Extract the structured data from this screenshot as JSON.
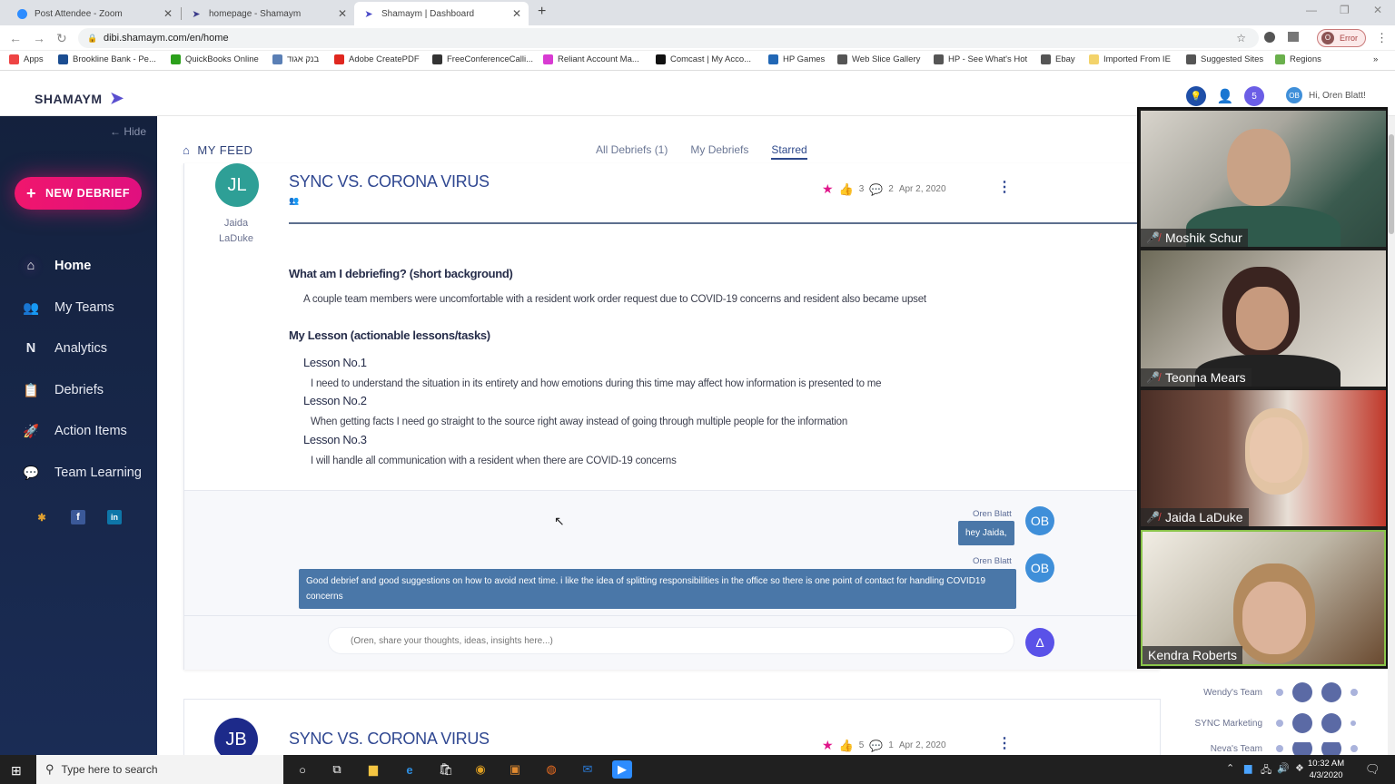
{
  "browser": {
    "tabs": [
      {
        "label": "Post Attendee - Zoom",
        "icon": "zoom-icon"
      },
      {
        "label": "homepage - Shamaym",
        "icon": "shamaym-icon"
      },
      {
        "label": "Shamaym | Dashboard",
        "icon": "shamaym-icon",
        "active": true
      }
    ],
    "url": "dibi.shamaym.com/en/home",
    "error_label": "Error",
    "profile_initial": "O",
    "bookmarks": [
      {
        "label": "Apps",
        "icon": "apps-grid-icon",
        "color": "#e44"
      },
      {
        "label": "Brookline Bank - Pe...",
        "icon": "bb-icon",
        "color": "#1b4d91"
      },
      {
        "label": "QuickBooks Online",
        "icon": "quickbooks-icon",
        "color": "#2ca01c"
      },
      {
        "label": "בנק אגוד",
        "icon": "bank-icon",
        "color": "#5a7fb5"
      },
      {
        "label": "Adobe CreatePDF",
        "icon": "adobe-icon",
        "color": "#e0271f"
      },
      {
        "label": "FreeConferenceCalli...",
        "icon": "conference-icon",
        "color": "#333"
      },
      {
        "label": "Reliant Account Ma...",
        "icon": "reliant-icon",
        "color": "#d83bd2"
      },
      {
        "label": "Comcast | My Acco...",
        "icon": "comcast-icon",
        "color": "#111"
      },
      {
        "label": "HP Games",
        "icon": "hp-games-icon",
        "color": "#2167b5"
      },
      {
        "label": "Web Slice Gallery",
        "icon": "globe-icon",
        "color": "#555"
      },
      {
        "label": "HP - See What's Hot",
        "icon": "globe-icon",
        "color": "#555"
      },
      {
        "label": "Ebay",
        "icon": "globe-icon",
        "color": "#555"
      },
      {
        "label": "Imported From IE",
        "icon": "folder-icon",
        "color": "#f3d36b"
      },
      {
        "label": "Suggested Sites",
        "icon": "globe-icon",
        "color": "#555"
      },
      {
        "label": "Regions",
        "icon": "regions-icon",
        "color": "#6ab04c"
      }
    ]
  },
  "app": {
    "logo": "SHAMAYM",
    "greeting": "Hi, Oren Blatt!",
    "user_initials": "OB",
    "notification_count": "5",
    "hide_label": "Hide",
    "new_debrief_label": "NEW DEBRIEF",
    "nav": [
      {
        "label": "Home",
        "icon": "home-icon",
        "active": true
      },
      {
        "label": "My Teams",
        "icon": "teams-icon"
      },
      {
        "label": "Analytics",
        "icon": "analytics-icon"
      },
      {
        "label": "Debriefs",
        "icon": "debriefs-icon"
      },
      {
        "label": "Action Items",
        "icon": "rocket-icon"
      },
      {
        "label": "Team Learning",
        "icon": "chat-icon"
      }
    ],
    "social": [
      "slack-icon",
      "facebook-icon",
      "linkedin-icon"
    ]
  },
  "feed": {
    "title": "MY FEED",
    "tabs": [
      "All Debriefs (1)",
      "My Debriefs",
      "Starred"
    ],
    "selected_tab": "Starred",
    "posts": [
      {
        "author_initials": "JL",
        "author_first": "Jaida",
        "author_last": "LaDuke",
        "avatar_color": "#2e9f96",
        "title": "SYNC VS. CORONA VIRUS",
        "likes": "3",
        "comments_count": "2",
        "date": "Apr 2, 2020",
        "background_heading": "What am I debriefing? (short background)",
        "background_text": "A couple team members were uncomfortable with a resident work order request due to COVID-19 concerns and resident also became upset",
        "lessons_heading": "My Lesson (actionable lessons/tasks)",
        "lessons": [
          {
            "title": "Lesson No.1",
            "text": "I need to understand the situation in its entirety and how emotions during this time may affect how information is presented to me"
          },
          {
            "title": "Lesson No.2",
            "text": "When getting facts I need go straight to the source right away instead of going through multiple people for the information"
          },
          {
            "title": "Lesson No.3",
            "text": "I will handle all communication with a resident when there are COVID-19 concerns"
          }
        ],
        "comments": [
          {
            "author": "Oren Blatt",
            "initials": "OB",
            "text": "hey Jaida,"
          },
          {
            "author": "Oren Blatt",
            "initials": "OB",
            "text": "Good debrief and good suggestions on how to avoid next time. i like the idea of splitting responsibilities in the office so there is one point of contact for handling COVID19 concerns"
          }
        ],
        "comment_placeholder": "(Oren, share your thoughts, ideas, insights here...)"
      },
      {
        "author_initials": "JB",
        "avatar_color": "#1d2a8a",
        "title": "SYNC VS. CORONA VIRUS",
        "likes": "5",
        "comments_count": "1",
        "date": "Apr 2, 2020"
      }
    ]
  },
  "teams_widget": [
    {
      "name": "Wendy's Team"
    },
    {
      "name": "SYNC Marketing"
    },
    {
      "name": "Neva's Team"
    }
  ],
  "zoom": {
    "participants": [
      {
        "name": "Moshik Schur",
        "muted": true
      },
      {
        "name": "Teonna Mears",
        "muted": true
      },
      {
        "name": "Jaida LaDuke",
        "muted": true
      },
      {
        "name": "Kendra Roberts",
        "muted": false,
        "active_speaker": true
      }
    ]
  },
  "taskbar": {
    "search_placeholder": "Type here to search",
    "time": "10:32 AM",
    "date": "4/3/2020"
  }
}
